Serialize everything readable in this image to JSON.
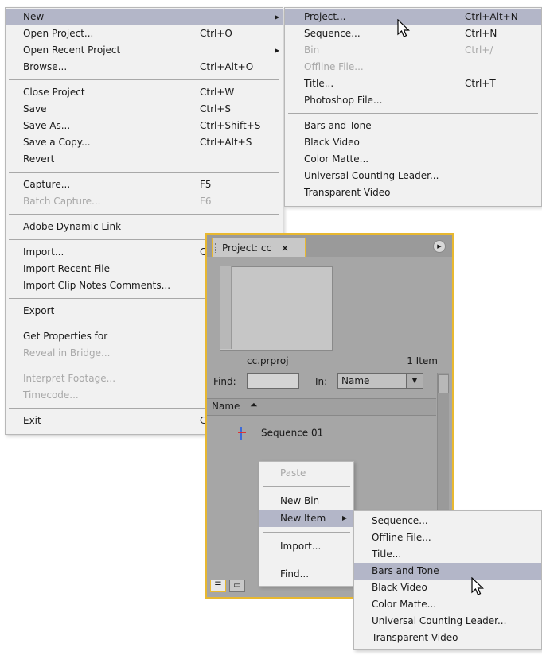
{
  "file_menu": {
    "groups": [
      [
        {
          "label": "New",
          "shortcut": "",
          "submenu": true,
          "highlight": true
        },
        {
          "label": "Open Project...",
          "shortcut": "Ctrl+O"
        },
        {
          "label": "Open Recent Project",
          "shortcut": "",
          "submenu": true
        },
        {
          "label": "Browse...",
          "shortcut": "Ctrl+Alt+O"
        }
      ],
      [
        {
          "label": "Close Project",
          "shortcut": "Ctrl+W"
        },
        {
          "label": "Save",
          "shortcut": "Ctrl+S"
        },
        {
          "label": "Save As...",
          "shortcut": "Ctrl+Shift+S"
        },
        {
          "label": "Save a Copy...",
          "shortcut": "Ctrl+Alt+S"
        },
        {
          "label": "Revert",
          "shortcut": ""
        }
      ],
      [
        {
          "label": "Capture...",
          "shortcut": "F5"
        },
        {
          "label": "Batch Capture...",
          "shortcut": "F6",
          "disabled": true
        }
      ],
      [
        {
          "label": "Adobe Dynamic Link",
          "shortcut": ""
        }
      ],
      [
        {
          "label": "Import...",
          "shortcut": "C"
        },
        {
          "label": "Import Recent File",
          "shortcut": ""
        },
        {
          "label": "Import Clip Notes Comments...",
          "shortcut": ""
        }
      ],
      [
        {
          "label": "Export",
          "shortcut": ""
        }
      ],
      [
        {
          "label": "Get Properties for",
          "shortcut": ""
        },
        {
          "label": "Reveal in Bridge...",
          "shortcut": "",
          "disabled": true
        }
      ],
      [
        {
          "label": "Interpret Footage...",
          "shortcut": "",
          "disabled": true
        },
        {
          "label": "Timecode...",
          "shortcut": "",
          "disabled": true
        }
      ],
      [
        {
          "label": "Exit",
          "shortcut": "C"
        }
      ]
    ]
  },
  "new_submenu": {
    "groups": [
      [
        {
          "label": "Project...",
          "shortcut": "Ctrl+Alt+N",
          "highlight": true
        },
        {
          "label": "Sequence...",
          "shortcut": "Ctrl+N"
        },
        {
          "label": "Bin",
          "shortcut": "Ctrl+/",
          "disabled": true
        },
        {
          "label": "Offline File...",
          "shortcut": "",
          "disabled": true
        },
        {
          "label": "Title...",
          "shortcut": "Ctrl+T"
        },
        {
          "label": "Photoshop File...",
          "shortcut": ""
        }
      ],
      [
        {
          "label": "Bars and Tone",
          "shortcut": ""
        },
        {
          "label": "Black Video",
          "shortcut": ""
        },
        {
          "label": "Color Matte...",
          "shortcut": ""
        },
        {
          "label": "Universal Counting Leader...",
          "shortcut": ""
        },
        {
          "label": "Transparent Video",
          "shortcut": ""
        }
      ]
    ]
  },
  "project_panel": {
    "tab_label": "Project: cc",
    "close_glyph": "×",
    "project_name": "cc.prproj",
    "item_count": "1 Item",
    "find_label": "Find:",
    "find_value": "",
    "in_label": "In:",
    "in_value": "Name",
    "column_name": "Name",
    "sequence_label": "Sequence 01"
  },
  "context_menu": {
    "groups": [
      [
        {
          "label": "Paste",
          "disabled": true
        }
      ],
      [
        {
          "label": "New Bin"
        },
        {
          "label": "New Item",
          "submenu": true,
          "highlight": true
        }
      ],
      [
        {
          "label": "Import..."
        }
      ],
      [
        {
          "label": "Find..."
        }
      ]
    ]
  },
  "new_item_submenu": {
    "items": [
      {
        "label": "Sequence..."
      },
      {
        "label": "Offline File..."
      },
      {
        "label": "Title..."
      },
      {
        "label": "Bars and Tone",
        "highlight": true
      },
      {
        "label": "Black Video"
      },
      {
        "label": "Color Matte..."
      },
      {
        "label": "Universal Counting Leader..."
      },
      {
        "label": "Transparent Video"
      }
    ]
  },
  "colors": {
    "menu_bg": "#f1f1f1",
    "highlight": "#b3b6c8",
    "panel_border": "#e8b830",
    "disabled_text": "#a8a8a8"
  },
  "icons": [
    "submenu-arrow-icon",
    "close-icon",
    "panel-menu-icon",
    "sort-ascending-icon",
    "sequence-icon",
    "list-view-icon",
    "icon-view-icon",
    "mouse-pointer-icon"
  ]
}
